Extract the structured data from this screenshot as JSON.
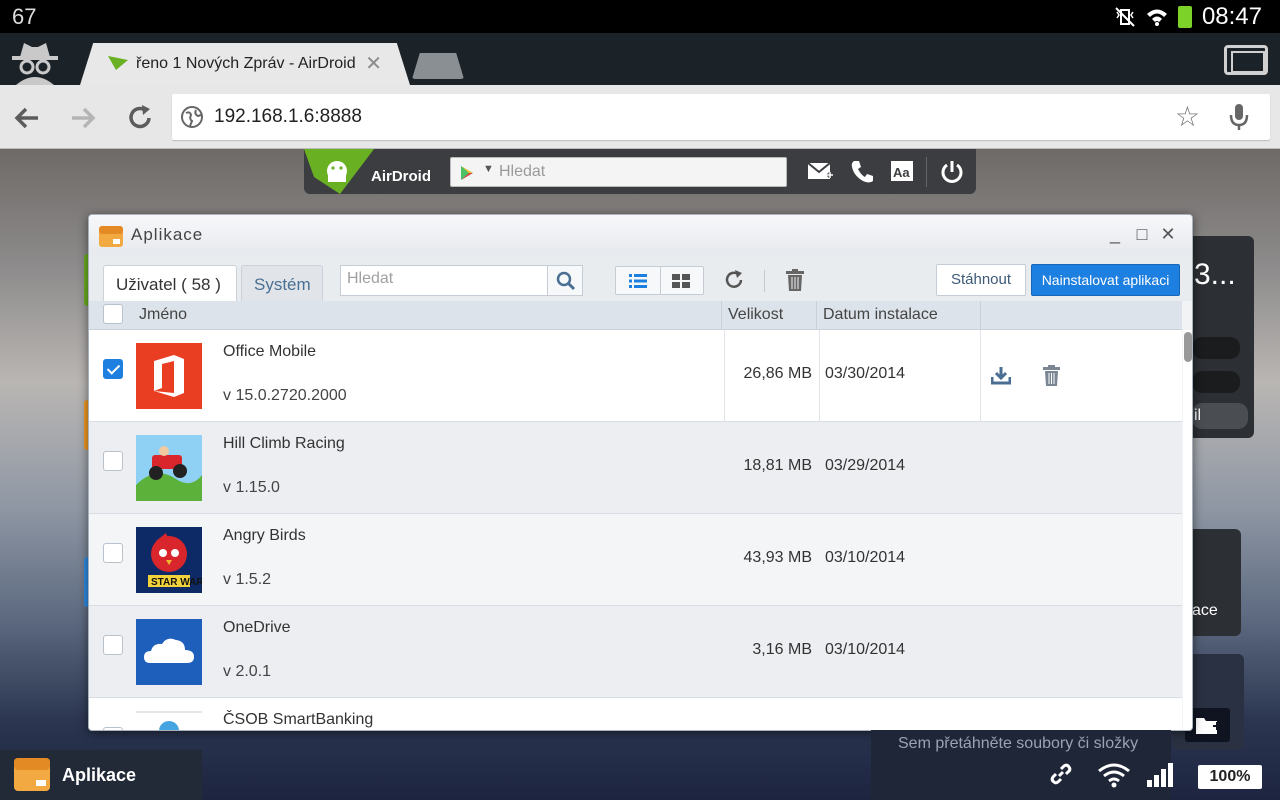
{
  "status_bar": {
    "left_text": "67",
    "clock": "08:47"
  },
  "browser": {
    "tab_title": "řeno 1 Nových Zpráv - AirDroid",
    "tab_close": "✕",
    "url": "192.168.1.6:8888"
  },
  "airdroid": {
    "brand": "AirDroid",
    "search_placeholder": "Hledat"
  },
  "background": {
    "card_top_text": "3...",
    "card_side_text": "il",
    "card_apps_text": "ace",
    "drop_text": "Sem přetáhněte soubory či složky",
    "battery_percent": "100%"
  },
  "window": {
    "title": "Aplikace",
    "tabs": [
      {
        "label": "Uživatel ( 58 )",
        "active": true
      },
      {
        "label": "Systém",
        "active": false
      }
    ],
    "search_placeholder": "Hledat",
    "download_button": "Stáhnout",
    "install_button": "Nainstalovat aplikaci",
    "columns": {
      "name": "Jméno",
      "size": "Velikost",
      "date": "Datum instalace"
    },
    "apps": [
      {
        "name": "Office Mobile",
        "version": "v 15.0.2720.2000",
        "size": "26,86 MB",
        "date": "03/30/2014",
        "checked": true,
        "icon": "office-icon"
      },
      {
        "name": "Hill Climb Racing",
        "version": "v 1.15.0",
        "size": "18,81 MB",
        "date": "03/29/2014",
        "checked": false,
        "icon": "hill-climb-icon"
      },
      {
        "name": "Angry Birds",
        "version": "v 1.5.2",
        "size": "43,93 MB",
        "date": "03/10/2014",
        "checked": false,
        "icon": "angry-birds-star-wars-icon"
      },
      {
        "name": "OneDrive",
        "version": "v 2.0.1",
        "size": "3,16 MB",
        "date": "03/10/2014",
        "checked": false,
        "icon": "onedrive-icon"
      },
      {
        "name": "ČSOB SmartBanking",
        "version": "",
        "size": "",
        "date": "",
        "checked": false,
        "icon": "csob-icon"
      }
    ]
  },
  "dock": {
    "label": "Aplikace"
  }
}
